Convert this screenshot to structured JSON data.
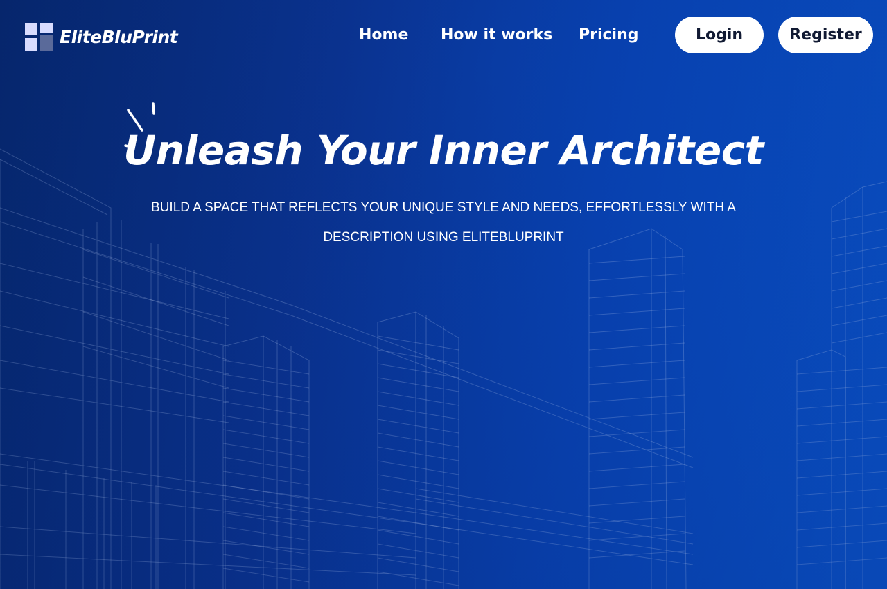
{
  "brand": {
    "name": "EliteBluPrint",
    "icon": "logo-squares-icon"
  },
  "nav": {
    "items": [
      {
        "label": "Home"
      },
      {
        "label": "How it works"
      },
      {
        "label": "Pricing"
      }
    ]
  },
  "auth": {
    "login_label": "Login",
    "register_label": "Register"
  },
  "hero": {
    "title": "Unleash Your Inner Architect",
    "subtitle": "BUILD A SPACE THAT REFLECTS YOUR UNIQUE STYLE AND NEEDS, EFFORTLESSLY WITH A DESCRIPTION USING ELITEBLUPRINT",
    "decoration_icon": "sparkle-lines-icon"
  },
  "background": {
    "description_icon": "wireframe-city-illustration",
    "colors": {
      "gradient_start": "#06286e",
      "gradient_end": "#0a55cf",
      "wire": "#b8cdf5"
    }
  }
}
